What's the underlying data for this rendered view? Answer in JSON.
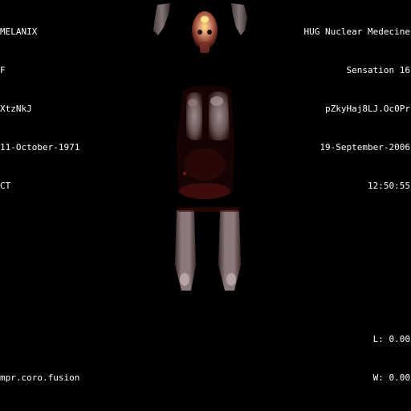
{
  "patient": {
    "name": "MELANIX",
    "sex": "F",
    "id": "XtzNkJ",
    "birth_date": "11-October-1971",
    "modality": "CT"
  },
  "study": {
    "institution": "HUG Nuclear Medecine",
    "scanner": "Sensation 16",
    "study_uid": "pZkyHaj8LJ.Oc0Pr",
    "date": "19-September-2006",
    "time": "12:50:55"
  },
  "series": {
    "description": "mpr.coro.fusion"
  },
  "window": {
    "level_label": "L: 0.00",
    "width_label": "W: 0.00"
  },
  "image": {
    "view": "coronal PET/CT fusion MPR",
    "background_color": "#000000",
    "tissue_color": "#6e5a5a",
    "uptake_color": "#8a1010",
    "hotspot_color": "#f0d060"
  }
}
